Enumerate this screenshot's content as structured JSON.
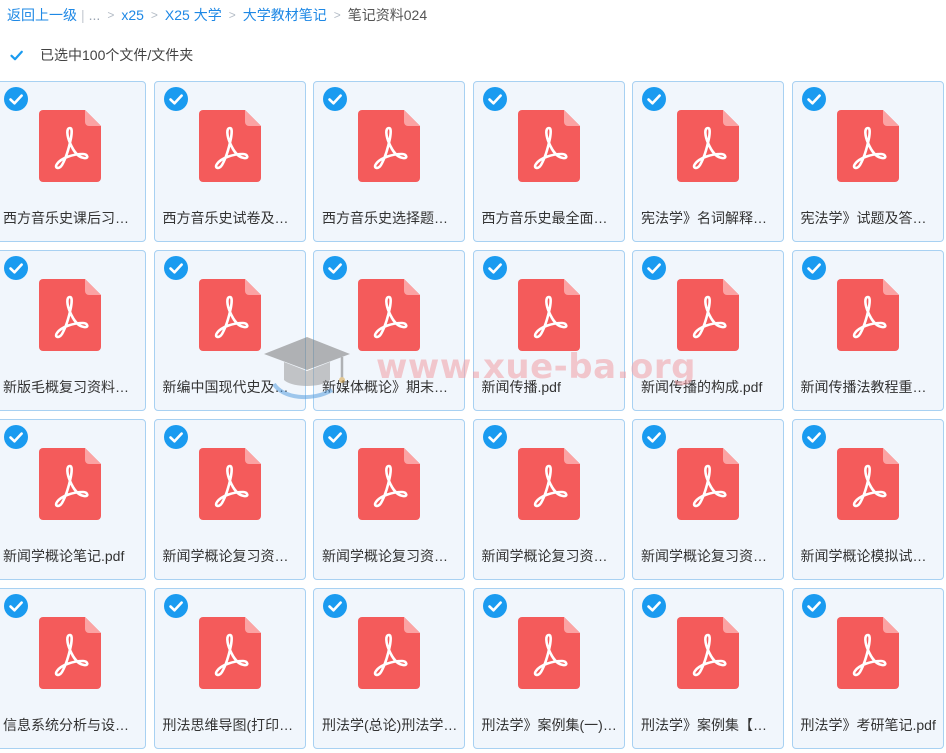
{
  "breadcrumb": {
    "back": "返回上一级",
    "ellipsis": "...",
    "items": [
      "x25",
      "X25 大学",
      "大学教材笔记"
    ],
    "current": "笔记资料024"
  },
  "selection": {
    "label": "已选中100个文件/文件夹",
    "checked": true
  },
  "watermark": {
    "text": "www.xue-ba.org"
  },
  "colors": {
    "accent": "#1e88e5",
    "check": "#1a9bf0",
    "pdf_red": "#f45b5b",
    "tile_bg": "#f1f6fc",
    "tile_border": "#a8d1f2"
  },
  "icons": {
    "check": "check-circle-icon",
    "file": "pdf-file-icon",
    "watermark": "graduation-cap-icon"
  },
  "files": [
    {
      "name": "西方音乐史课后习题答案.pdf",
      "selected": true
    },
    {
      "name": "西方音乐史试卷及答案.pdf",
      "selected": true
    },
    {
      "name": "西方音乐史选择题及答案.pdf",
      "selected": true
    },
    {
      "name": "西方音乐史最全面复习资料.pdf",
      "selected": true
    },
    {
      "name": "宪法学》名词解释汇总.pdf",
      "selected": true
    },
    {
      "name": "宪法学》试题及答案.pdf",
      "selected": true
    },
    {
      "name": "新版毛概复习资料汇总.pdf",
      "selected": true
    },
    {
      "name": "新编中国现代史及答案.pdf",
      "selected": true
    },
    {
      "name": "新媒体概论》期末复习.pdf",
      "selected": true
    },
    {
      "name": "新闻传播.pdf",
      "selected": true
    },
    {
      "name": "新闻传播的构成.pdf",
      "selected": true
    },
    {
      "name": "新闻传播法教程重点笔记.pdf",
      "selected": true
    },
    {
      "name": "新闻学概论笔记.pdf",
      "selected": true
    },
    {
      "name": "新闻学概论复习资料(一).pdf",
      "selected": true
    },
    {
      "name": "新闻学概论复习资料(二).pdf",
      "selected": true
    },
    {
      "name": "新闻学概论复习资料(三).pdf",
      "selected": true
    },
    {
      "name": "新闻学概论复习资料(四).pdf",
      "selected": true
    },
    {
      "name": "新闻学概论模拟试题.pdf",
      "selected": true
    },
    {
      "name": "信息系统分析与设计.pdf",
      "selected": true
    },
    {
      "name": "刑法思维导图(打印版).pdf",
      "selected": true
    },
    {
      "name": "刑法学(总论)刑法学.pdf",
      "selected": true
    },
    {
      "name": "刑法学》案例集(一).pdf",
      "selected": true
    },
    {
      "name": "刑法学》案例集【二】.pdf",
      "selected": true
    },
    {
      "name": "刑法学》考研笔记.pdf",
      "selected": true
    }
  ]
}
